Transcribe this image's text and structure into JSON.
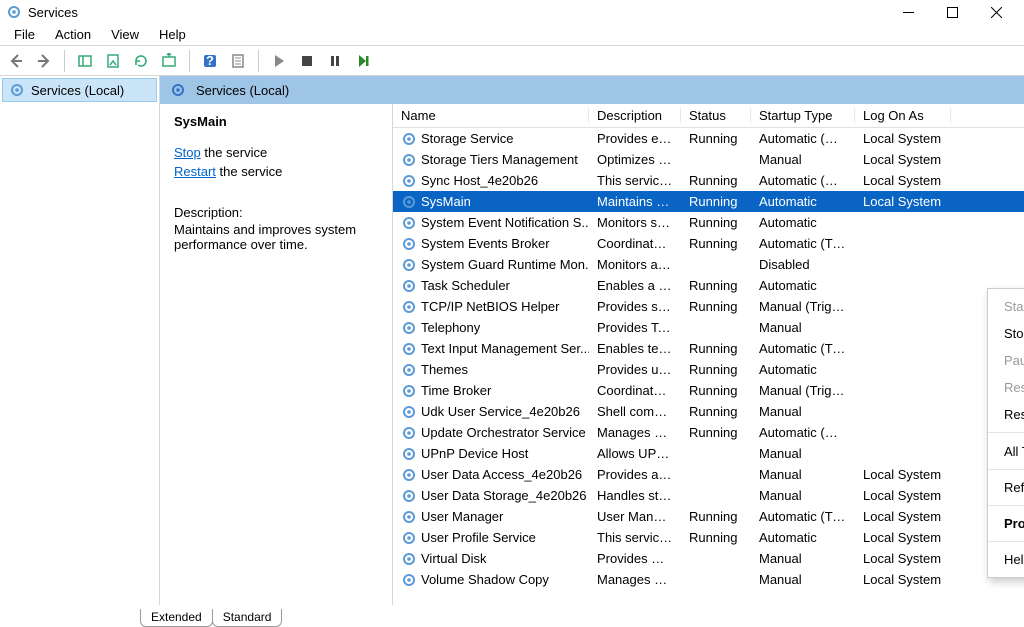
{
  "window": {
    "title": "Services"
  },
  "menubar": [
    "File",
    "Action",
    "View",
    "Help"
  ],
  "nav": {
    "item": "Services (Local)"
  },
  "header": {
    "title": "Services (Local)"
  },
  "detail": {
    "service_name": "SysMain",
    "stop_link": "Stop",
    "stop_rest": " the service",
    "restart_link": "Restart",
    "restart_rest": " the service",
    "desc_label": "Description:",
    "desc_text": "Maintains and improves system performance over time."
  },
  "columns": {
    "name": "Name",
    "description": "Description",
    "status": "Status",
    "startup": "Startup Type",
    "logon": "Log On As"
  },
  "rows": [
    {
      "name": "Storage Service",
      "desc": "Provides ena...",
      "status": "Running",
      "startup": "Automatic (De...",
      "logon": "Local System",
      "selected": false
    },
    {
      "name": "Storage Tiers Management",
      "desc": "Optimizes th...",
      "status": "",
      "startup": "Manual",
      "logon": "Local System",
      "selected": false
    },
    {
      "name": "Sync Host_4e20b26",
      "desc": "This service ...",
      "status": "Running",
      "startup": "Automatic (De...",
      "logon": "Local System",
      "selected": false
    },
    {
      "name": "SysMain",
      "desc": "Maintains a...",
      "status": "Running",
      "startup": "Automatic",
      "logon": "Local System",
      "selected": true
    },
    {
      "name": "System Event Notification S...",
      "desc": "Monitors sy...",
      "status": "Running",
      "startup": "Automatic",
      "logon": "",
      "selected": false
    },
    {
      "name": "System Events Broker",
      "desc": "Coordinates ...",
      "status": "Running",
      "startup": "Automatic (Tri...",
      "logon": "",
      "selected": false
    },
    {
      "name": "System Guard Runtime Mon...",
      "desc": "Monitors an...",
      "status": "",
      "startup": "Disabled",
      "logon": "",
      "selected": false
    },
    {
      "name": "Task Scheduler",
      "desc": "Enables a us...",
      "status": "Running",
      "startup": "Automatic",
      "logon": "",
      "selected": false
    },
    {
      "name": "TCP/IP NetBIOS Helper",
      "desc": "Provides sup...",
      "status": "Running",
      "startup": "Manual (Trigg...",
      "logon": "",
      "selected": false
    },
    {
      "name": "Telephony",
      "desc": "Provides Tel...",
      "status": "",
      "startup": "Manual",
      "logon": "",
      "selected": false
    },
    {
      "name": "Text Input Management Ser...",
      "desc": "Enables text ...",
      "status": "Running",
      "startup": "Automatic (Tri...",
      "logon": "",
      "selected": false
    },
    {
      "name": "Themes",
      "desc": "Provides use...",
      "status": "Running",
      "startup": "Automatic",
      "logon": "",
      "selected": false
    },
    {
      "name": "Time Broker",
      "desc": "Coordinates ...",
      "status": "Running",
      "startup": "Manual (Trigg...",
      "logon": "",
      "selected": false
    },
    {
      "name": "Udk User Service_4e20b26",
      "desc": "Shell compo...",
      "status": "Running",
      "startup": "Manual",
      "logon": "",
      "selected": false
    },
    {
      "name": "Update Orchestrator Service",
      "desc": "Manages Wi...",
      "status": "Running",
      "startup": "Automatic (De...",
      "logon": "",
      "selected": false
    },
    {
      "name": "UPnP Device Host",
      "desc": "Allows UPnP ...",
      "status": "",
      "startup": "Manual",
      "logon": "",
      "selected": false
    },
    {
      "name": "User Data Access_4e20b26",
      "desc": "Provides ap...",
      "status": "",
      "startup": "Manual",
      "logon": "Local System",
      "selected": false
    },
    {
      "name": "User Data Storage_4e20b26",
      "desc": "Handles stor...",
      "status": "",
      "startup": "Manual",
      "logon": "Local System",
      "selected": false
    },
    {
      "name": "User Manager",
      "desc": "User Manag...",
      "status": "Running",
      "startup": "Automatic (Tri...",
      "logon": "Local System",
      "selected": false
    },
    {
      "name": "User Profile Service",
      "desc": "This service i...",
      "status": "Running",
      "startup": "Automatic",
      "logon": "Local System",
      "selected": false
    },
    {
      "name": "Virtual Disk",
      "desc": "Provides ma...",
      "status": "",
      "startup": "Manual",
      "logon": "Local System",
      "selected": false
    },
    {
      "name": "Volume Shadow Copy",
      "desc": "Manages an...",
      "status": "",
      "startup": "Manual",
      "logon": "Local System",
      "selected": false
    }
  ],
  "tabs": {
    "extended": "Extended",
    "standard": "Standard"
  },
  "context_menu": {
    "start": "Start",
    "stop": "Stop",
    "pause": "Pause",
    "resume": "Resume",
    "restart": "Restart",
    "all_tasks": "All Tasks",
    "refresh": "Refresh",
    "properties": "Properties",
    "help": "Help"
  }
}
